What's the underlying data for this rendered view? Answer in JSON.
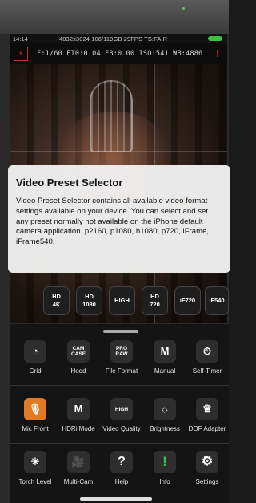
{
  "status": {
    "time": "14:14",
    "info": "4032x3024 106/119GB 29FPS TS:FAIR"
  },
  "exposure": {
    "flash_symbol": "⚡",
    "values": "F:1/60  ET0:0.04  EB:0.00  ISO:541  WB:4886",
    "rec_symbol": "!"
  },
  "info_card": {
    "title": "Video Preset Selector",
    "body": "Video Preset Selector contains all available video format settings available on your device. You can select and set any preset normally not available on the iPhone default camera application. p2160, p1080, h1080, p720, iFrame, iFrame540."
  },
  "presets": [
    {
      "line1": "HD",
      "line2": "4K"
    },
    {
      "line1": "HD",
      "line2": "1080"
    },
    {
      "line1": "HIGH",
      "line2": ""
    },
    {
      "line1": "HD",
      "line2": "720"
    },
    {
      "line1": "iF720",
      "line2": ""
    },
    {
      "line1": "iF540",
      "line2": ""
    }
  ],
  "tools": [
    {
      "label": "Grid",
      "icon": "◔"
    },
    {
      "label": "Hood",
      "icon1": "CAM",
      "icon2": "CASE"
    },
    {
      "label": "File Format",
      "icon1": "PRO",
      "icon2": "RAW"
    },
    {
      "label": "Manual",
      "icon": "M"
    },
    {
      "label": "Self-Timer",
      "icon": "⏱"
    },
    {
      "label": "Mic Front",
      "icon": "🎙"
    },
    {
      "label": "HDRi Mode",
      "icon": "M"
    },
    {
      "label": "Video Quality",
      "icon1": "HIGH",
      "icon2": ""
    },
    {
      "label": "Brightness",
      "icon": "☼"
    },
    {
      "label": "DOF Adapter",
      "icon": "♕"
    },
    {
      "label": "Torch Level",
      "icon": "☀"
    },
    {
      "label": "Multi-Cam",
      "icon": "🎥"
    },
    {
      "label": "Help",
      "icon": "?"
    },
    {
      "label": "Info",
      "icon": "!"
    },
    {
      "label": "Settings",
      "icon": "⚙"
    }
  ],
  "colors": {
    "accent_orange": "#e07b22",
    "info_green": "#35c24a",
    "rec_red": "#dd2222",
    "battery_green": "#3fbf3f"
  }
}
